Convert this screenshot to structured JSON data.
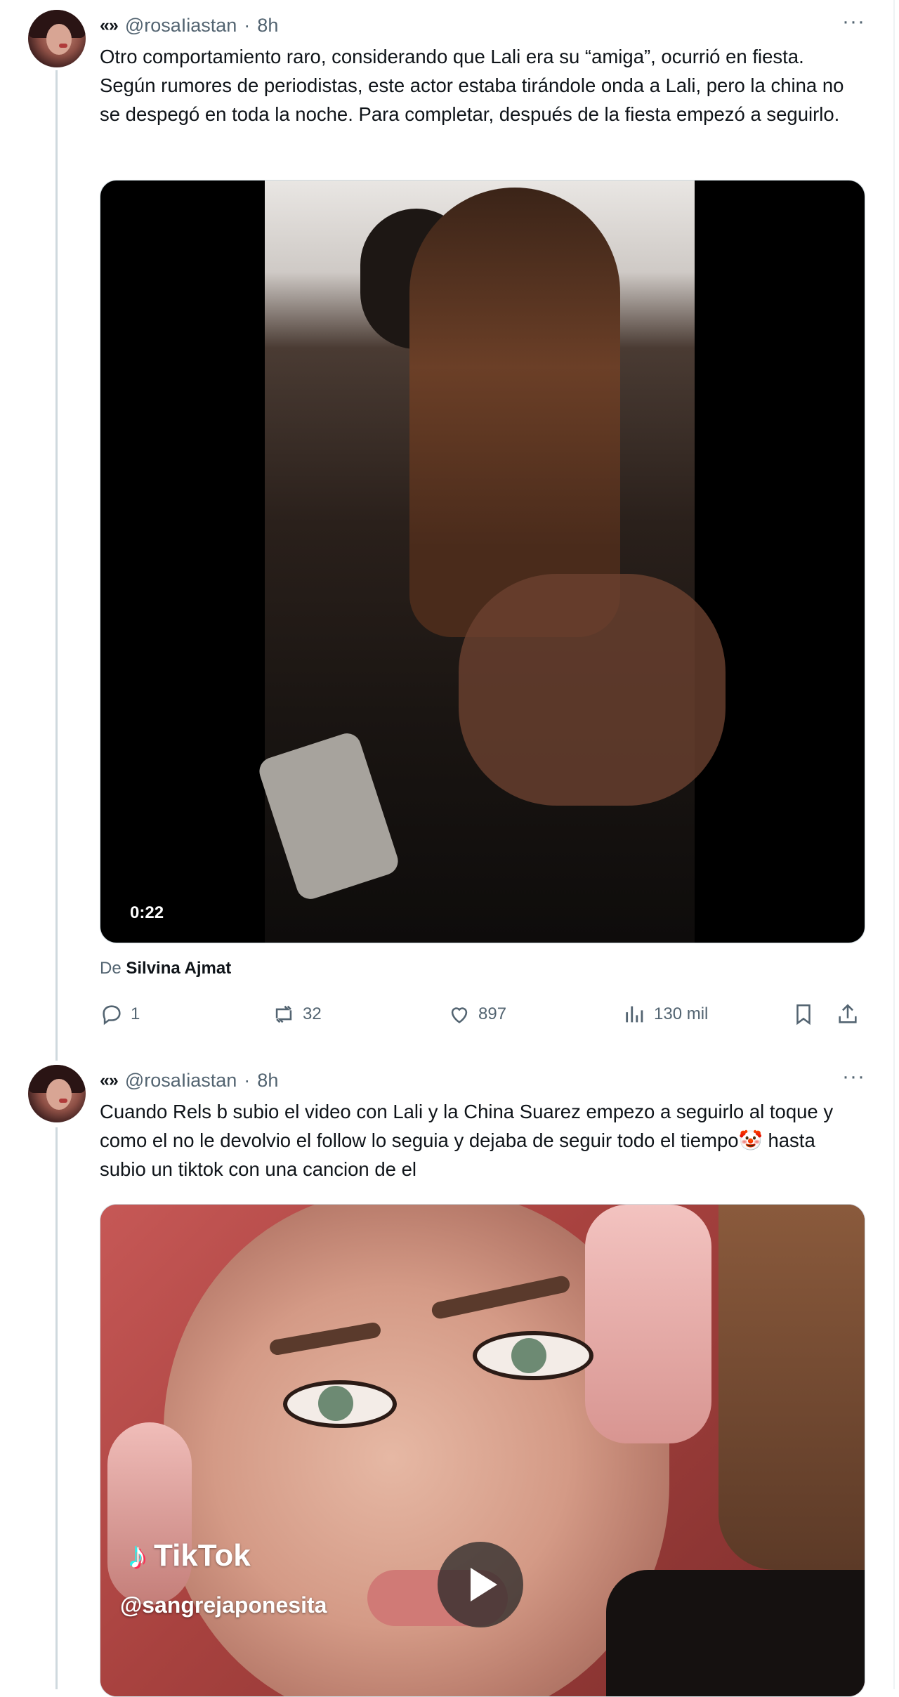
{
  "tweets": [
    {
      "prefix": "«»",
      "handle": "@rosaIiastan",
      "time": "8h",
      "more": "···",
      "text": "Otro comportamiento raro, considerando que Lali era su “amiga”, ocurrió en fiesta. Según rumores de periodistas, este actor estaba tirándole onda a Lali, pero la china no se despegó en toda la noche. Para completar, después de la fiesta empezó a seguirlo.",
      "video_duration": "0:22",
      "credit_prefix": "De",
      "credit_name": "Silvina Ajmat",
      "replies": "1",
      "reposts": "32",
      "likes": "897",
      "views": "130 mil"
    },
    {
      "prefix": "«»",
      "handle": "@rosaIiastan",
      "time": "8h",
      "more": "···",
      "text": "Cuando Rels b subio el video con Lali y la China Suarez empezo a seguirlo al toque y como el no le devolvio el follow lo seguia y dejaba de seguir todo el tiempo🤡 hasta subio un tiktok con una cancion de el",
      "tiktok_brand": "TikTok",
      "tiktok_handle": "@sangrejaponesita"
    }
  ],
  "icons": [
    "reply-icon",
    "repost-icon",
    "like-icon",
    "views-icon",
    "bookmark-icon",
    "share-icon",
    "more-icon",
    "play-icon",
    "tiktok-logo-icon"
  ]
}
